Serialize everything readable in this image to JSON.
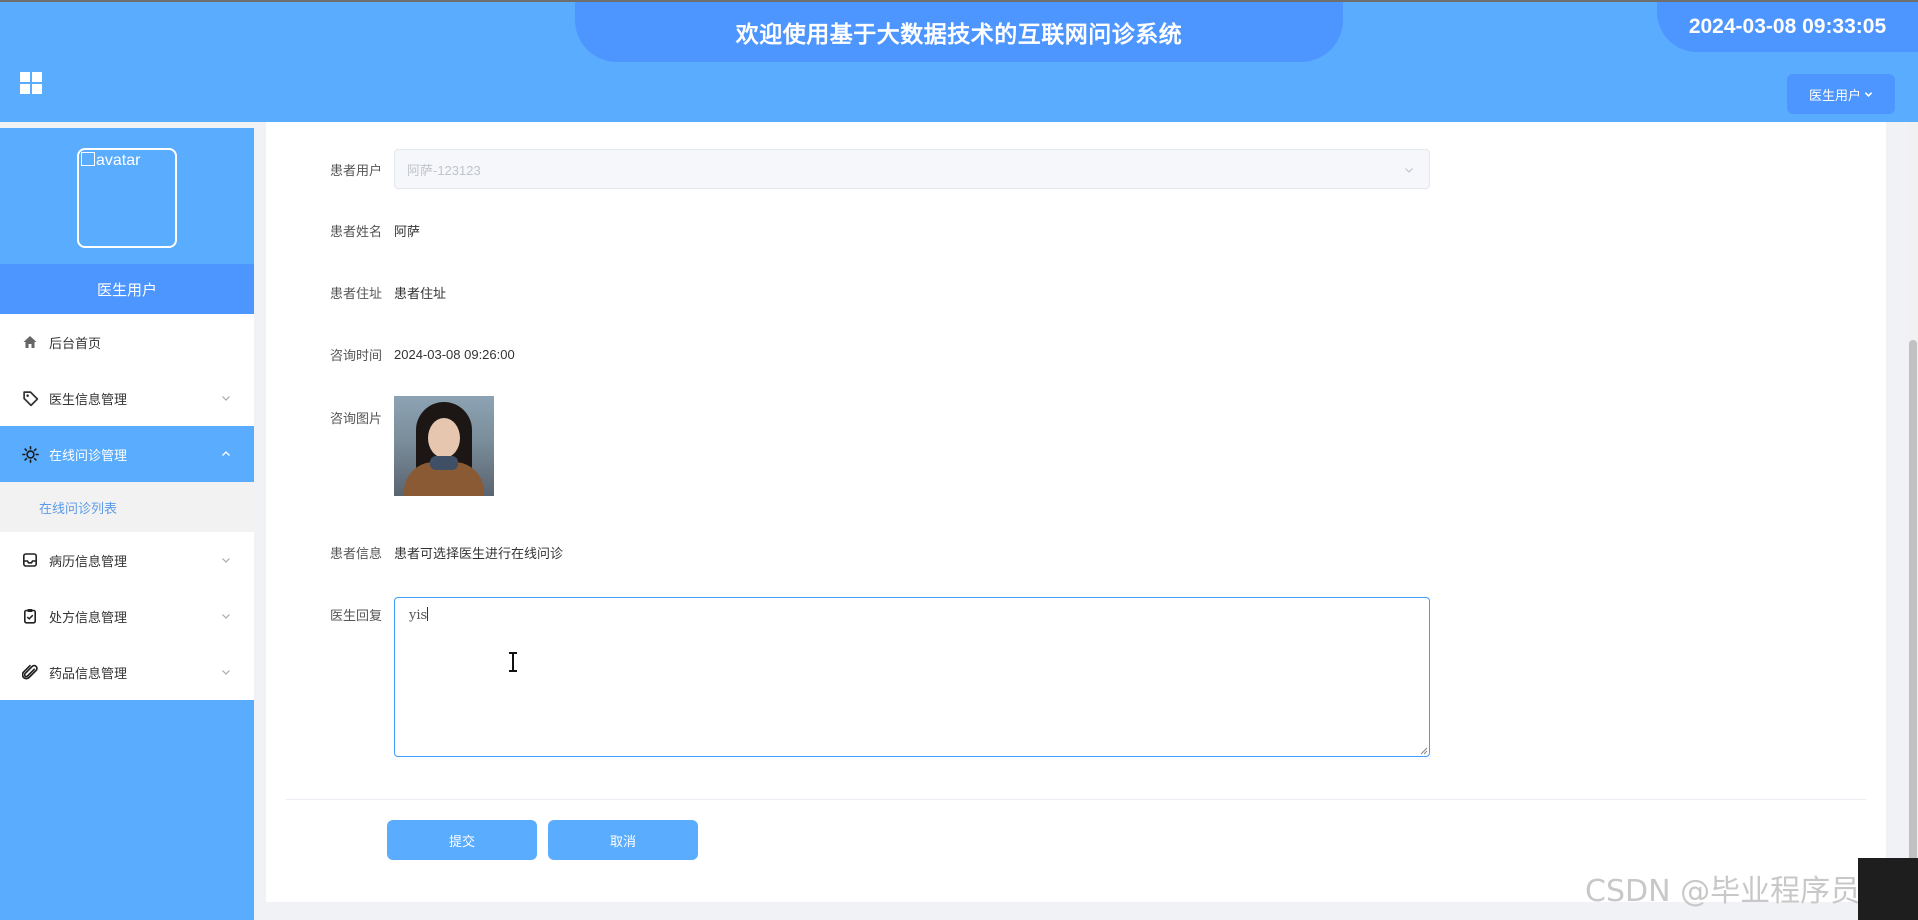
{
  "header": {
    "title": "欢迎使用基于大数据技术的互联网问诊系统",
    "datetime": "2024-03-08 09:33:05",
    "user_menu_label": "医生用户"
  },
  "sidebar": {
    "avatar_alt": "avatar",
    "role": "医生用户",
    "items": [
      {
        "label": "后台首页",
        "icon": "home-icon"
      },
      {
        "label": "医生信息管理",
        "icon": "tag-icon"
      },
      {
        "label": "在线问诊管理",
        "icon": "sun-icon"
      },
      {
        "label": "病历信息管理",
        "icon": "inbox-icon"
      },
      {
        "label": "处方信息管理",
        "icon": "clipboard-icon"
      },
      {
        "label": "药品信息管理",
        "icon": "paperclip-icon"
      }
    ],
    "submenu": {
      "label": "在线问诊列表"
    }
  },
  "form": {
    "patient_user": {
      "label": "患者用户",
      "placeholder": "阿萨-123123"
    },
    "patient_name": {
      "label": "患者姓名",
      "value": "阿萨"
    },
    "patient_address": {
      "label": "患者住址",
      "value": "患者住址"
    },
    "consult_time": {
      "label": "咨询时间",
      "value": "2024-03-08 09:26:00"
    },
    "consult_image": {
      "label": "咨询图片"
    },
    "patient_info": {
      "label": "患者信息",
      "value": "患者可选择医生进行在线问诊"
    },
    "doctor_reply": {
      "label": "医生回复",
      "value": "yis"
    }
  },
  "buttons": {
    "submit": "提交",
    "cancel": "取消"
  },
  "watermark": "CSDN @毕业程序员",
  "colors": {
    "primary": "#5aacff",
    "primary_dark": "#4d95ff",
    "focus_border": "#409eff"
  }
}
